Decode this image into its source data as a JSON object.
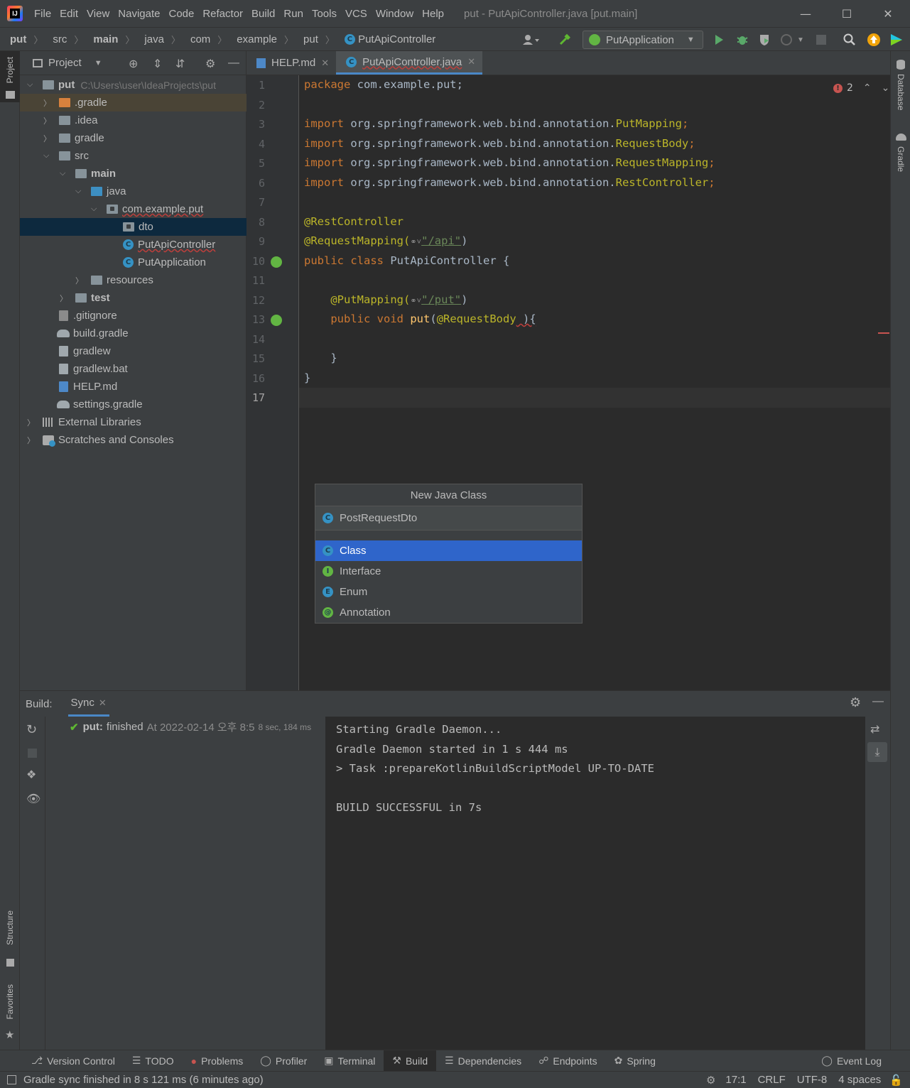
{
  "window": {
    "title": "put - PutApiController.java [put.main]",
    "menu": [
      "File",
      "Edit",
      "View",
      "Navigate",
      "Code",
      "Refactor",
      "Build",
      "Run",
      "Tools",
      "VCS",
      "Window",
      "Help"
    ]
  },
  "breadcrumb": [
    "put",
    "src",
    "main",
    "java",
    "com",
    "example",
    "put",
    "PutApiController"
  ],
  "toolbar": {
    "run_config": "PutApplication"
  },
  "project_panel": {
    "title": "Project",
    "root_name": "put",
    "root_path": "C:\\Users\\user\\IdeaProjects\\put",
    "items": [
      {
        "label": ".gradle"
      },
      {
        "label": ".idea"
      },
      {
        "label": "gradle"
      },
      {
        "label": "src"
      },
      {
        "label": "main"
      },
      {
        "label": "java"
      },
      {
        "label": "com.example.put"
      },
      {
        "label": "dto"
      },
      {
        "label": "PutApiController"
      },
      {
        "label": "PutApplication"
      },
      {
        "label": "resources"
      },
      {
        "label": "test"
      },
      {
        "label": ".gitignore"
      },
      {
        "label": "build.gradle"
      },
      {
        "label": "gradlew"
      },
      {
        "label": "gradlew.bat"
      },
      {
        "label": "HELP.md"
      },
      {
        "label": "settings.gradle"
      },
      {
        "label": "External Libraries"
      },
      {
        "label": "Scratches and Consoles"
      }
    ]
  },
  "side_tabs": {
    "left_top": "Project",
    "left_structure": "Structure",
    "left_favorites": "Favorites",
    "right_database": "Database",
    "right_gradle": "Gradle"
  },
  "editor": {
    "tabs": [
      {
        "label": "HELP.md"
      },
      {
        "label": "PutApiController.java"
      }
    ],
    "error_count": "2",
    "line_numbers": [
      "1",
      "2",
      "3",
      "4",
      "5",
      "6",
      "7",
      "8",
      "9",
      "10",
      "11",
      "12",
      "13",
      "14",
      "15",
      "16",
      "17"
    ],
    "code": {
      "l1_kw": "package",
      "l1_rest": " com.example.put;",
      "import_kw": "import",
      "l3_pkg": " org.springframework.web.bind.annotation.",
      "l3_cls": "PutMapping",
      "semi": ";",
      "l4_cls": "RequestBody",
      "l5_cls": "RequestMapping",
      "l6_cls": "RestController",
      "l8": "@RestController",
      "l9_ann": "@RequestMapping(",
      "l9_str": "\"/api\"",
      "close_paren": ")",
      "l10_kw1": "public",
      "l10_kw2": "class",
      "l10_rest": " PutApiController {",
      "l12_ann": "@PutMapping(",
      "l12_str": "\"/put\"",
      "l13_kw1": "public",
      "l13_kw2": "void",
      "l13_fn": "put",
      "l13_open": "(",
      "l13_ann": "@RequestBody",
      "l13_rest": " ){",
      "l15": "}",
      "l16": "}"
    }
  },
  "popup": {
    "title": "New Java Class",
    "input_value": "PostRequestDto",
    "options": [
      {
        "label": "Class",
        "icon": "C"
      },
      {
        "label": "Interface",
        "icon": "I"
      },
      {
        "label": "Enum",
        "icon": "E"
      },
      {
        "label": "Annotation",
        "icon": "@"
      }
    ]
  },
  "build": {
    "label": "Build:",
    "tab": "Sync",
    "sync_name": "put:",
    "sync_status": "finished",
    "sync_time": "At 2022-02-14 오후 8:5",
    "sync_duration": "8 sec, 184 ms",
    "console": "Starting Gradle Daemon...\nGradle Daemon started in 1 s 444 ms\n> Task :prepareKotlinBuildScriptModel UP-TO-DATE\n\nBUILD SUCCESSFUL in 7s"
  },
  "bottom_tabs": [
    "Version Control",
    "TODO",
    "Problems",
    "Profiler",
    "Terminal",
    "Build",
    "Dependencies",
    "Endpoints",
    "Spring"
  ],
  "event_log": "Event Log",
  "status": {
    "message": "Gradle sync finished in 8 s 121 ms (6 minutes ago)",
    "position": "17:1",
    "line_sep": "CRLF",
    "encoding": "UTF-8",
    "indent": "4 spaces"
  },
  "colors": {
    "accent": "#2f65ca",
    "keyword": "#cc7832",
    "annotation": "#bbb529",
    "string": "#6a8759",
    "error": "#c75450",
    "success": "#5fb832"
  }
}
